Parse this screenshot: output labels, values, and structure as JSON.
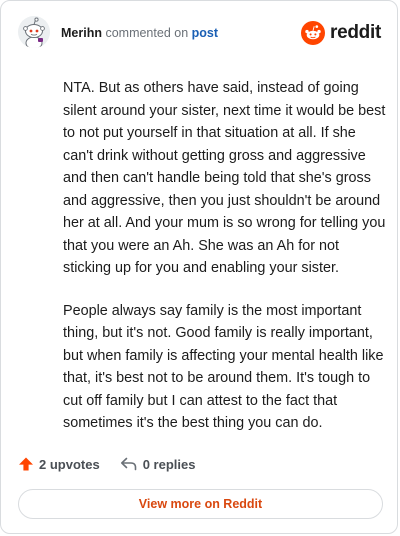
{
  "comment": {
    "author": "Merihn",
    "action_text": " commented on ",
    "post_link": "post",
    "paragraphs": [
      "NTA. But as others have said, instead of going silent around your sister, next time it would be best to not put yourself in that situation at all. If she can't drink without getting gross and aggressive and then can't handle being told that she's gross and aggressive, then you just shouldn't be around her at all. And your mum is so wrong for telling you that you were an Ah. She was an Ah for not sticking up for you and enabling your sister.",
      "People always say family is the most important thing, but it's not. Good family is really important, but when family is affecting your mental health like that, it's best not to be around them. It's tough to cut off family but I can attest to the fact that sometimes it's the best thing you can do."
    ]
  },
  "brand": {
    "name": "reddit",
    "icon": "reddit-logo-icon",
    "color": "#ff4500"
  },
  "actions": {
    "upvotes_label": "2 upvotes",
    "upvote_icon": "upvote-arrow-icon",
    "replies_label": "0 replies",
    "reply_icon": "reply-arrow-icon"
  },
  "view_more": {
    "label": "View more on Reddit",
    "color": "#d9480f"
  }
}
